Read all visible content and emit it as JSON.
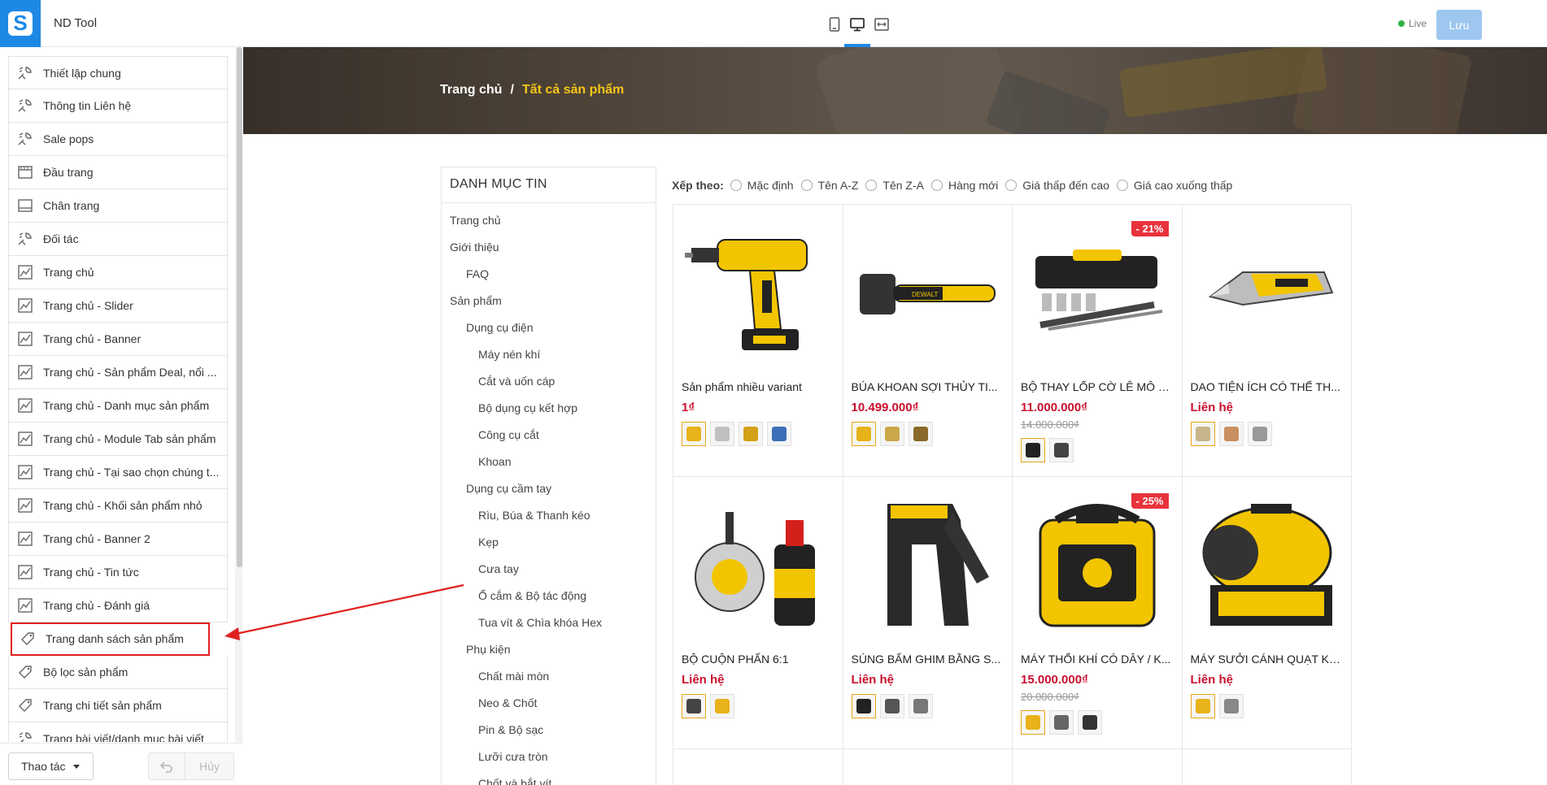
{
  "app": {
    "name": "ND Tool",
    "logo_letter": "S"
  },
  "sidebar": {
    "items": [
      {
        "label": "Thiết lập chung",
        "icon": "settings-brush-icon"
      },
      {
        "label": "Thông tin Liên hệ",
        "icon": "settings-brush-icon"
      },
      {
        "label": "Sale pops",
        "icon": "settings-brush-icon"
      },
      {
        "label": "Đầu trang",
        "icon": "header-layout-icon"
      },
      {
        "label": "Chân trang",
        "icon": "footer-layout-icon"
      },
      {
        "label": "Đối tác",
        "icon": "settings-brush-icon"
      },
      {
        "label": "Trang chủ",
        "icon": "page-chart-icon"
      },
      {
        "label": "Trang chủ - Slider",
        "icon": "page-chart-icon"
      },
      {
        "label": "Trang chủ - Banner",
        "icon": "page-chart-icon"
      },
      {
        "label": "Trang chủ - Sản phẩm Deal, nổi ...",
        "icon": "page-chart-icon"
      },
      {
        "label": "Trang chủ - Danh mục sản phẩm",
        "icon": "page-chart-icon"
      },
      {
        "label": "Trang chủ - Module Tab sản phẩm",
        "icon": "page-chart-icon"
      },
      {
        "label": "Trang chủ - Tại sao chọn chúng t...",
        "icon": "page-chart-icon"
      },
      {
        "label": "Trang chủ - Khối sản phẩm nhỏ",
        "icon": "page-chart-icon"
      },
      {
        "label": "Trang chủ - Banner 2",
        "icon": "page-chart-icon"
      },
      {
        "label": "Trang chủ - Tin tức",
        "icon": "page-chart-icon"
      },
      {
        "label": "Trang chủ - Đánh giá",
        "icon": "page-chart-icon"
      },
      {
        "label": "Trang danh sách sản phẩm",
        "icon": "tag-icon",
        "highlighted": true
      },
      {
        "label": "Bộ lọc sản phẩm",
        "icon": "tag-icon"
      },
      {
        "label": "Trang chi tiết sản phẩm",
        "icon": "tag-icon"
      },
      {
        "label": "Trang bài viết/danh mục bài viết",
        "icon": "settings-brush-icon"
      }
    ],
    "footer": {
      "actions_label": "Thao tác",
      "cancel_label": "Hủy",
      "undo_icon": "undo-icon"
    }
  },
  "topbar": {
    "devices": [
      "mobile-icon",
      "desktop-icon",
      "fullwidth-icon"
    ],
    "active_device": "desktop-icon",
    "live_label": "Live",
    "save_label": "Lưu"
  },
  "page": {
    "breadcrumb": {
      "home": "Trang chủ",
      "separator": "/",
      "current": "Tất cả sản phẩm"
    },
    "category": {
      "title": "DANH MỤC TIN",
      "items": [
        {
          "label": "Trang chủ",
          "level": 0
        },
        {
          "label": "Giới thiệu",
          "level": 0
        },
        {
          "label": "FAQ",
          "level": 1
        },
        {
          "label": "Sản phẩm",
          "level": 0
        },
        {
          "label": "Dụng cụ điện",
          "level": 1
        },
        {
          "label": "Máy nén khí",
          "level": 2
        },
        {
          "label": "Cắt và uốn cáp",
          "level": 2
        },
        {
          "label": "Bộ dụng cụ kết hợp",
          "level": 2
        },
        {
          "label": "Công cụ cắt",
          "level": 2
        },
        {
          "label": "Khoan",
          "level": 2
        },
        {
          "label": "Dụng cụ cầm tay",
          "level": 1
        },
        {
          "label": "Rìu, Búa & Thanh kéo",
          "level": 2
        },
        {
          "label": "Kẹp",
          "level": 2
        },
        {
          "label": "Cưa tay",
          "level": 2
        },
        {
          "label": "Ổ cắm & Bộ tác động",
          "level": 2
        },
        {
          "label": "Tua vít & Chìa khóa Hex",
          "level": 2
        },
        {
          "label": "Phụ kiện",
          "level": 1
        },
        {
          "label": "Chất mài mòn",
          "level": 2
        },
        {
          "label": "Neo & Chốt",
          "level": 2
        },
        {
          "label": "Pin & Bộ sạc",
          "level": 2
        },
        {
          "label": "Lưỡi cưa tròn",
          "level": 2
        },
        {
          "label": "Chốt và bắt vít",
          "level": 2
        }
      ]
    },
    "sort": {
      "label": "Xếp theo:",
      "options": [
        "Mặc định",
        "Tên A-Z",
        "Tên Z-A",
        "Hàng mới",
        "Giá thấp đến cao",
        "Giá cao xuống thấp"
      ]
    },
    "products": [
      {
        "name": "Sản phẩm nhiều variant",
        "price": "1₫",
        "old_price": "",
        "discount": "",
        "image": "drill-icon",
        "swatches": [
          "#e8b21a",
          "#c0c0c0",
          "#d4a017",
          "#3b6fb6"
        ]
      },
      {
        "name": "BÚA KHOAN SỢI THỦY TI...",
        "price": "10.499.000₫",
        "old_price": "",
        "discount": "",
        "image": "hammer-icon",
        "swatches": [
          "#e8b21a",
          "#caa84a",
          "#8a6a2a"
        ]
      },
      {
        "name": "BỘ THAY LỐP CỜ LÊ MÔ M...",
        "price": "11.000.000₫",
        "old_price": "14.000.000₫",
        "discount": "- 21%",
        "image": "toolcase-icon",
        "swatches": [
          "#222222",
          "#444444"
        ]
      },
      {
        "name": "DAO TIỆN ÍCH CÓ THỂ TH...",
        "price": "Liên hệ",
        "old_price": "",
        "discount": "",
        "image": "utility-knife-icon",
        "swatches": [
          "#c7b48a",
          "#c89060",
          "#999999"
        ]
      },
      {
        "name": "BỘ CUỘN PHẤN 6:1",
        "price": "Liên hệ",
        "old_price": "",
        "discount": "",
        "image": "chalk-reel-icon",
        "swatches": [
          "#444444",
          "#e8b21a"
        ]
      },
      {
        "name": "SÚNG BẤM GHIM BẰNG S...",
        "price": "Liên hệ",
        "old_price": "",
        "discount": "",
        "image": "stapler-icon",
        "swatches": [
          "#222222",
          "#555555",
          "#777777"
        ]
      },
      {
        "name": "MÁY THỔI KHÍ CÓ DÂY / K...",
        "price": "15.000.000₫",
        "old_price": "20.000.000₫",
        "discount": "- 25%",
        "image": "inflator-icon",
        "swatches": [
          "#e8b21a",
          "#666666",
          "#333333"
        ]
      },
      {
        "name": "MÁY SƯỞI CÁNH QUẠT KH...",
        "price": "Liên hệ",
        "old_price": "",
        "discount": "",
        "image": "heater-icon",
        "swatches": [
          "#e8b21a",
          "#888888"
        ]
      }
    ]
  },
  "colors": {
    "accent": "#1e88e5",
    "price": "#c8102e",
    "badge": "#e8323c",
    "breadcrumb_current": "#f5c518",
    "annotation": "#e02020",
    "save_button": "#9ec7ef"
  }
}
